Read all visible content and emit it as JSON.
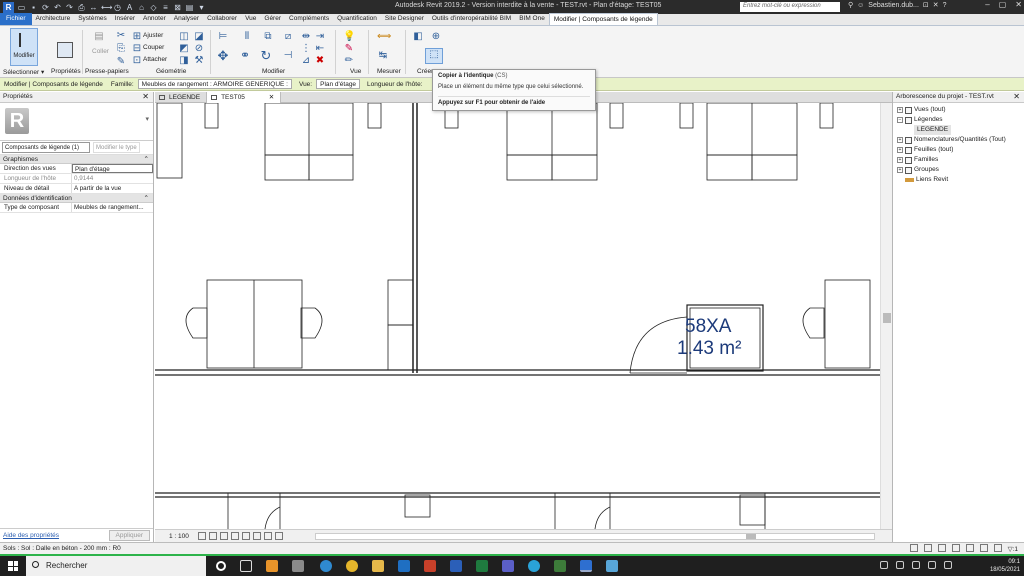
{
  "titlebar": {
    "title": "Autodesk Revit 2019.2 - Version interdite à la vente - TEST.rvt - Plan d'étage: TEST05",
    "search_placeholder": "Entrez mot-clé ou expression",
    "user": "Sebastien.dub...",
    "logo": "R"
  },
  "tabs": [
    "Fichier",
    "Architecture",
    "Systèmes",
    "Insérer",
    "Annoter",
    "Analyser",
    "Collaborer",
    "Vue",
    "Gérer",
    "Compléments",
    "Quantification",
    "Site Designer",
    "Outils d'interopérabilité BIM",
    "BIM One",
    "Modifier | Composants de légende"
  ],
  "ribbon": {
    "modify_label": "Modifier",
    "select_label": "Sélectionner ▾",
    "props_label": "Propriétés",
    "clipboard_label": "Presse-papiers",
    "paste_label": "Coller",
    "geometry_label": "Géométrie",
    "trim_label": "Ajuster",
    "cut_label": "Couper",
    "join_label": "Attacher",
    "modify_group_label": "Modifier",
    "view_group_label": "Vue",
    "measure_label": "Mesurer",
    "create_label": "Créer"
  },
  "optbar": {
    "context": "Modifier | Composants de légende",
    "family_label": "Famille:",
    "family_value": "Meubles de rangement : ARMOIRE GENERIQUE :",
    "view_label": "Vue:",
    "view_value": "Plan d'étage",
    "host_label": "Longueur de l'hôte:"
  },
  "tooltip": {
    "title": "Copier à l'identique",
    "shortcut": "(CS)",
    "description": "Place un élément du même type que celui sélectionné.",
    "help": "Appuyez sur F1 pour obtenir de l'aide"
  },
  "properties": {
    "header": "Propriétés",
    "logo": "R",
    "filter": "Composants de légende (1)",
    "edit_type": "Modifier le type",
    "graphics_cat": "Graphismes",
    "rows_graphics": [
      {
        "k": "Direction des vues",
        "v": "Plan d'étage"
      },
      {
        "k": "Longueur de l'hôte",
        "v": "0,9144"
      },
      {
        "k": "Niveau de détail",
        "v": "A partir de la vue"
      }
    ],
    "ident_cat": "Données d'identification",
    "rows_ident": [
      {
        "k": "Type de composant",
        "v": "Meubles de rangement..."
      }
    ],
    "help_link": "Aide des propriétés",
    "apply": "Appliquer"
  },
  "viewtabs": [
    {
      "label": "LEGENDE"
    },
    {
      "label": "TEST05"
    }
  ],
  "room": {
    "name": "58XA",
    "area": "1.43 m²"
  },
  "viewctrl": {
    "scale": "1 : 100"
  },
  "browser": {
    "header": "Arborescence du projet - TEST.rvt",
    "nodes": [
      {
        "label": "Vues (tout)"
      },
      {
        "label": "Légendes"
      },
      {
        "label": "LEGENDE"
      },
      {
        "label": "Nomenclatures/Quantités (Tout)"
      },
      {
        "label": "Feuilles (tout)"
      },
      {
        "label": "Familles"
      },
      {
        "label": "Groupes"
      },
      {
        "label": "Liens Revit"
      }
    ]
  },
  "statusbar": {
    "text": "Sols : Sol : Dalle en béton - 200 mm : R0",
    "filter": "▽:1"
  },
  "taskbar": {
    "search": "Rechercher",
    "time": "09:1",
    "date": "18/05/2021"
  },
  "colors": {
    "accent": "#2a6fc9",
    "optbar": "#e8f2c8",
    "room_tag": "#1c3a7a",
    "taskbar_line": "#2db34a"
  }
}
